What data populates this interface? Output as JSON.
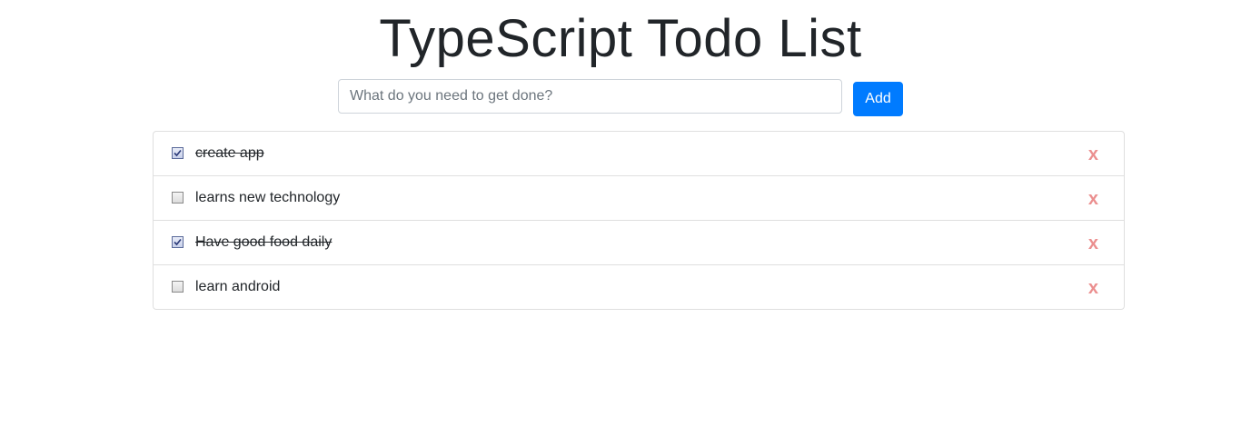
{
  "header": {
    "title": "TypeScript Todo List"
  },
  "form": {
    "input_value": "",
    "input_placeholder": "What do you need to get done?",
    "add_label": "Add"
  },
  "todos": [
    {
      "text": "create app",
      "done": true,
      "delete_label": "x"
    },
    {
      "text": "learns new technology",
      "done": false,
      "delete_label": "x"
    },
    {
      "text": "Have good food daily",
      "done": true,
      "delete_label": "x"
    },
    {
      "text": "learn android",
      "done": false,
      "delete_label": "x"
    }
  ],
  "colors": {
    "accent": "#007bff",
    "delete": "#eb8f8f",
    "border": "#dfdfdf"
  }
}
